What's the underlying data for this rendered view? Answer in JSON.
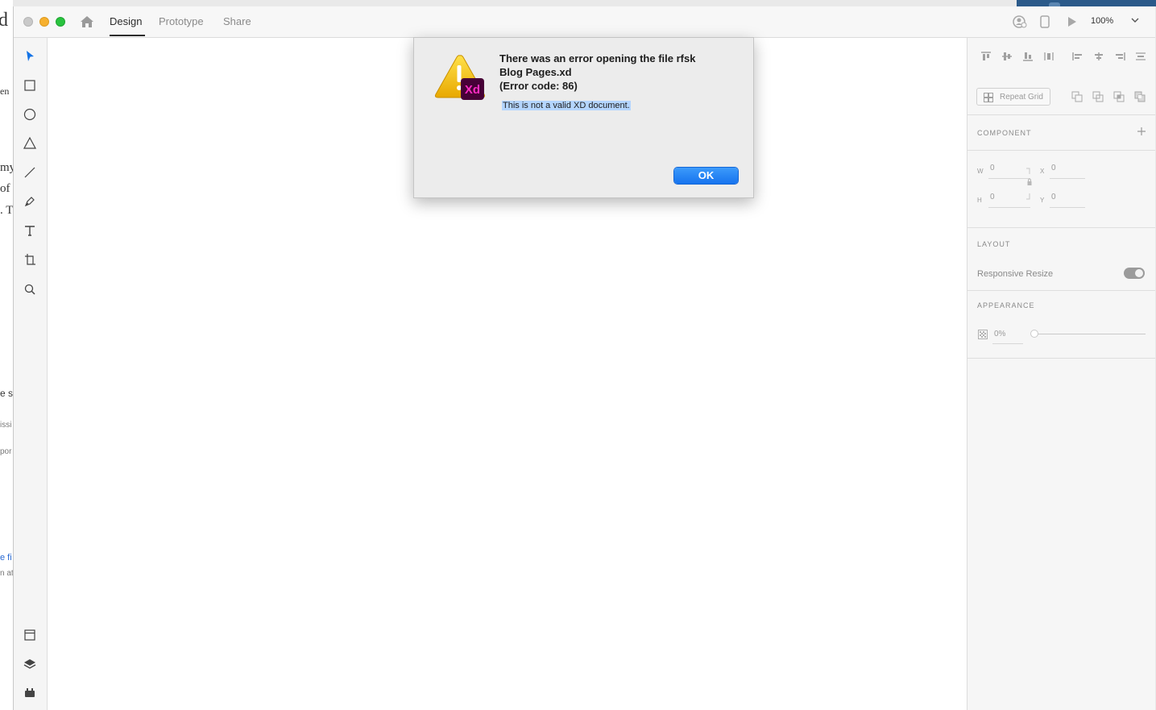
{
  "background_window": {
    "snippets": [
      "d",
      "en",
      "my",
      "of",
      ". T",
      "e s",
      "issi",
      "por",
      "e fi",
      "n at"
    ]
  },
  "window": {
    "tabs": [
      {
        "label": "Design",
        "active": true
      },
      {
        "label": "Prototype",
        "active": false
      },
      {
        "label": "Share",
        "active": false
      }
    ],
    "zoom_label": "100%"
  },
  "toolbar": {
    "tools": [
      "select-tool",
      "rectangle-tool",
      "ellipse-tool",
      "polygon-tool",
      "line-tool",
      "pen-tool",
      "text-tool",
      "artboard-tool",
      "zoom-tool"
    ],
    "bottom": [
      "assets-panel",
      "layers-panel",
      "plugins-panel"
    ]
  },
  "panel": {
    "repeat_grid_label": "Repeat Grid",
    "component_label": "COMPONENT",
    "w_label": "W",
    "w_value": "0",
    "h_label": "H",
    "h_value": "0",
    "x_label": "X",
    "x_value": "0",
    "y_label": "Y",
    "y_value": "0",
    "layout_label": "LAYOUT",
    "responsive_resize_label": "Responsive Resize",
    "responsive_resize_on": true,
    "appearance_label": "APPEARANCE",
    "opacity_value": "0%"
  },
  "dialog": {
    "title_line1": "There was an error opening the file rfsk",
    "title_line2": "Blog Pages.xd",
    "title_line3": "(Error code: 86)",
    "message": "This is not a valid XD document.",
    "ok_label": "OK",
    "icon_badge": "Xd"
  },
  "colors": {
    "accent": "#1473e6",
    "ok_button": "#1673ee",
    "selection_highlight": "#b4d5fe",
    "xd_magenta": "#ff2bc2",
    "warning_yellow": "#f5c518"
  }
}
